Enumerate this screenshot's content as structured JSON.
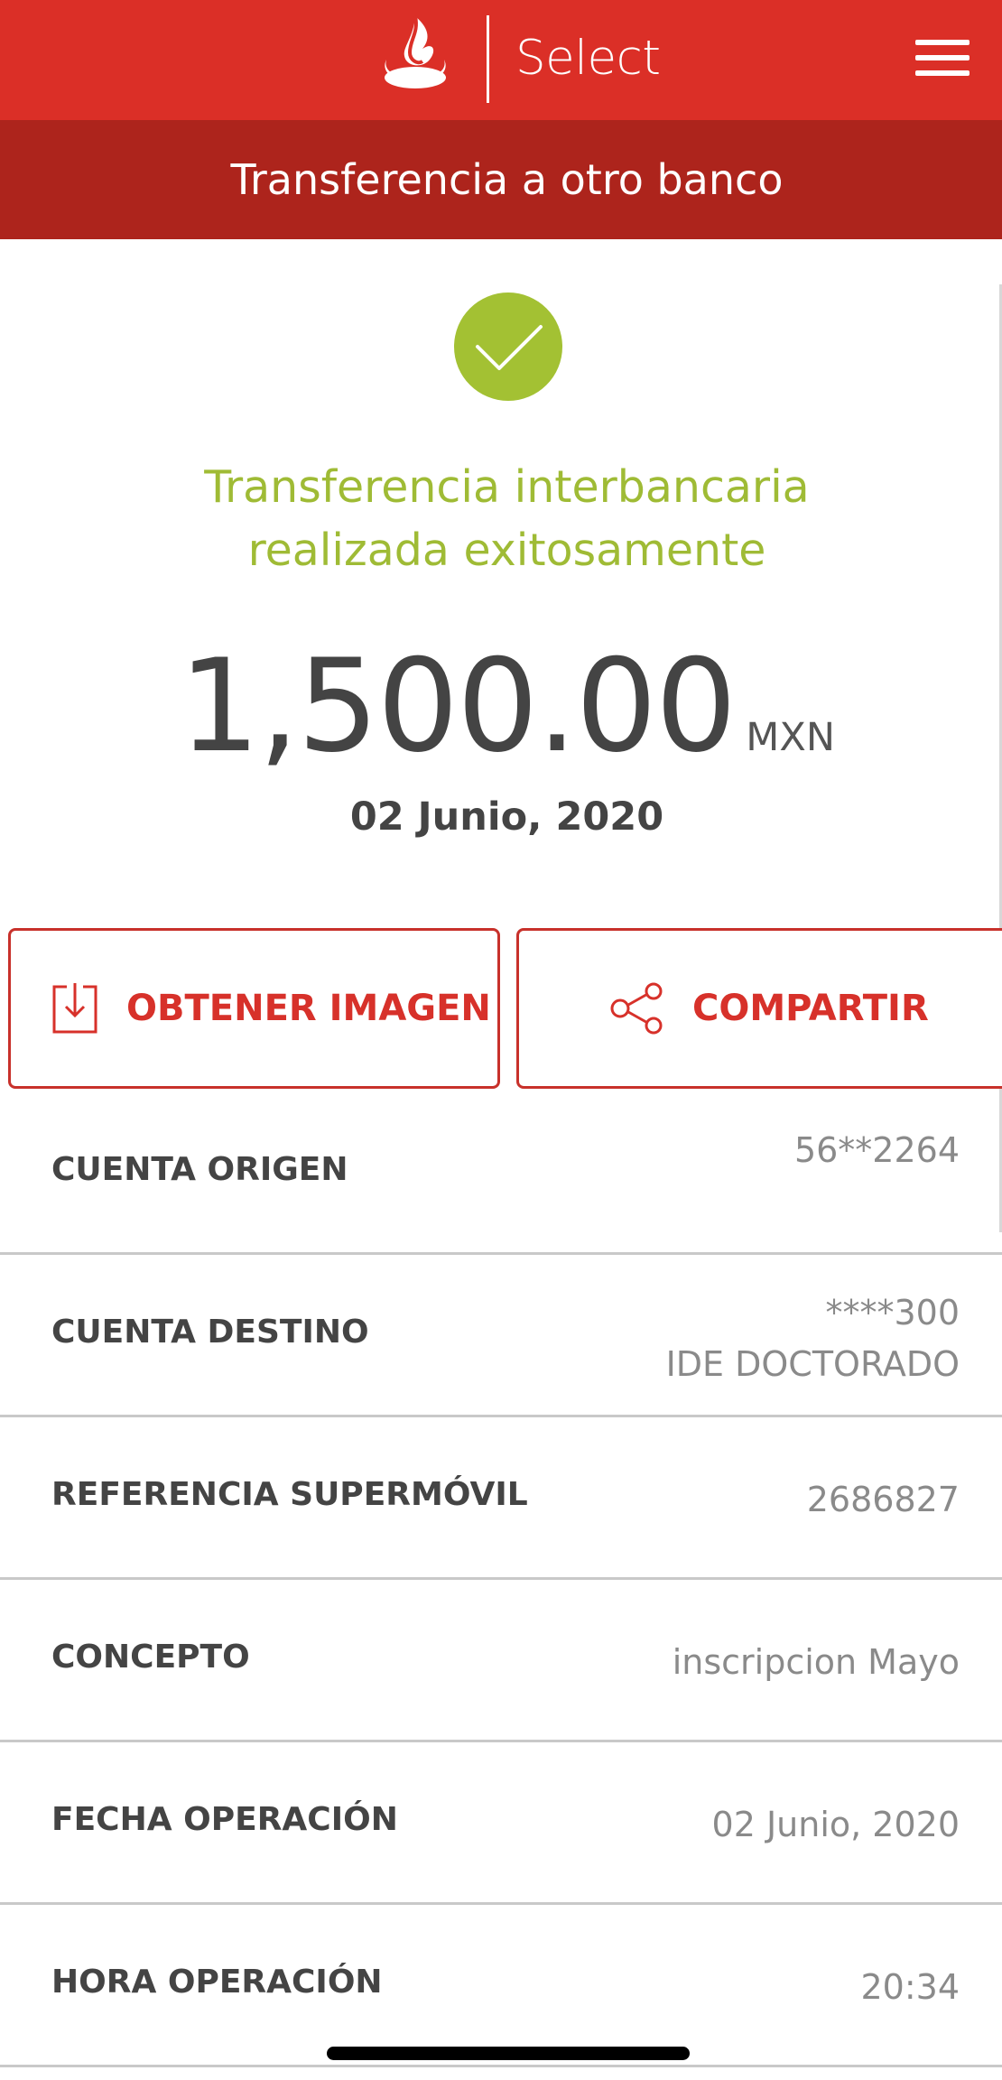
{
  "header": {
    "brand_label": "Select",
    "subtitle": "Transferencia a otro banco"
  },
  "status": {
    "message_line1": "Transferencia interbancaria",
    "message_line2": "realizada exitosamente"
  },
  "amount": {
    "value": "1,500.00",
    "currency": "MXN",
    "date": "02 Junio, 2020"
  },
  "actions": {
    "get_image_label": "OBTENER IMAGEN",
    "share_label": "COMPARTIR"
  },
  "details": [
    {
      "label": "CUENTA ORIGEN",
      "value": "56**2264"
    },
    {
      "label": "CUENTA DESTINO",
      "value": "****300",
      "value_line2": "IDE DOCTORADO"
    },
    {
      "label": "REFERENCIA SUPERMÓVIL",
      "value": "2686827"
    },
    {
      "label": "CONCEPTO",
      "value": "inscripcion Mayo"
    },
    {
      "label": "FECHA OPERACIÓN",
      "value": "02 Junio, 2020"
    },
    {
      "label": "HORA OPERACIÓN",
      "value": "20:34"
    }
  ],
  "icons": {
    "logo": "santander-flame-icon",
    "menu": "hamburger-menu-icon",
    "success": "check-icon",
    "download": "download-icon",
    "share": "share-icon"
  },
  "colors": {
    "header_red": "#db2f27",
    "subheader_red": "#ad241c",
    "success_green": "#a3c133",
    "accent_red": "#d7312a"
  }
}
